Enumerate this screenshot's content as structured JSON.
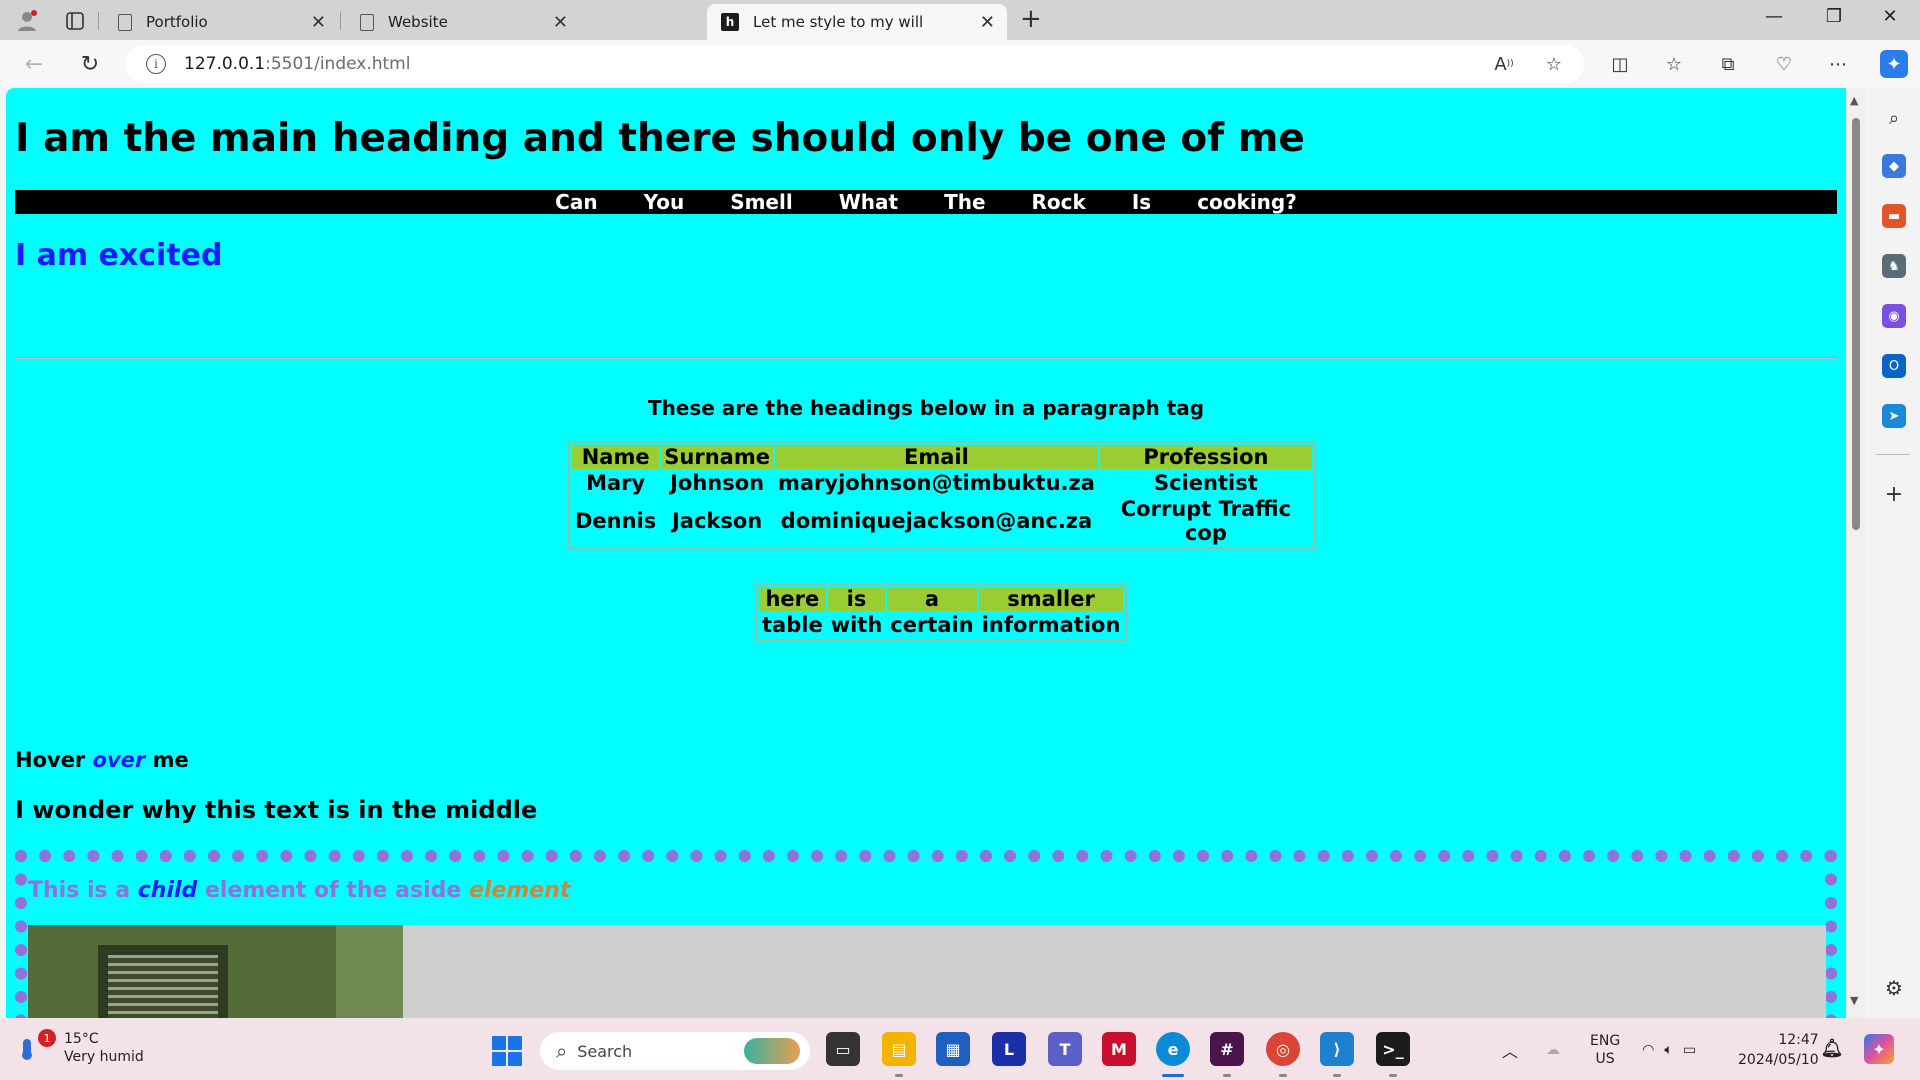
{
  "browser": {
    "tabs": [
      {
        "title": "Portfolio",
        "active": false
      },
      {
        "title": "Website",
        "active": false
      },
      {
        "title": "Let me style to my will",
        "active": true,
        "favicon_letter": "h"
      }
    ],
    "url_host": "127.0.0.1",
    "url_rest": ":5501/index.html"
  },
  "page": {
    "main_heading": "I am the main heading and there should only be one of me",
    "nav": [
      "Can",
      "You",
      "Smell",
      "What",
      "The",
      "Rock",
      "Is",
      "cooking?"
    ],
    "excited": "I am excited",
    "paragraph_heading": "These are the headings below in a paragraph tag",
    "main_table": {
      "headers": [
        "Name",
        "Surname",
        "Email",
        "Profession"
      ],
      "rows": [
        [
          "Mary",
          "Johnson",
          "maryjohnson@timbuktu.za",
          "Scientist"
        ],
        [
          "Dennis",
          "Jackson",
          "dominiquejackson@anc.za",
          "Corrupt Traffic cop"
        ]
      ]
    },
    "small_table": {
      "headers": [
        "here",
        "is",
        "a",
        "smaller"
      ],
      "rows": [
        [
          "table",
          "with",
          "certain",
          "information"
        ]
      ]
    },
    "hover": {
      "before": "Hover ",
      "em": "over",
      "after": " me"
    },
    "middle_text": "I wonder why this text is in the middle",
    "aside": {
      "part1": "This is a ",
      "child": "child",
      "part2": " element of the aside ",
      "element": "element"
    }
  },
  "colors": {
    "page_bg": "#00ffff",
    "nav_bg": "#000000",
    "table_header_bg": "#9acd32",
    "excited": "#1a1aff",
    "aside_border": "#9370db"
  },
  "taskbar": {
    "weather_temp": "15°C",
    "weather_desc": "Very humid",
    "weather_badge": "1",
    "search_placeholder": "Search",
    "lang_top": "ENG",
    "lang_bottom": "US",
    "time": "12:47",
    "date": "2024/05/10"
  }
}
